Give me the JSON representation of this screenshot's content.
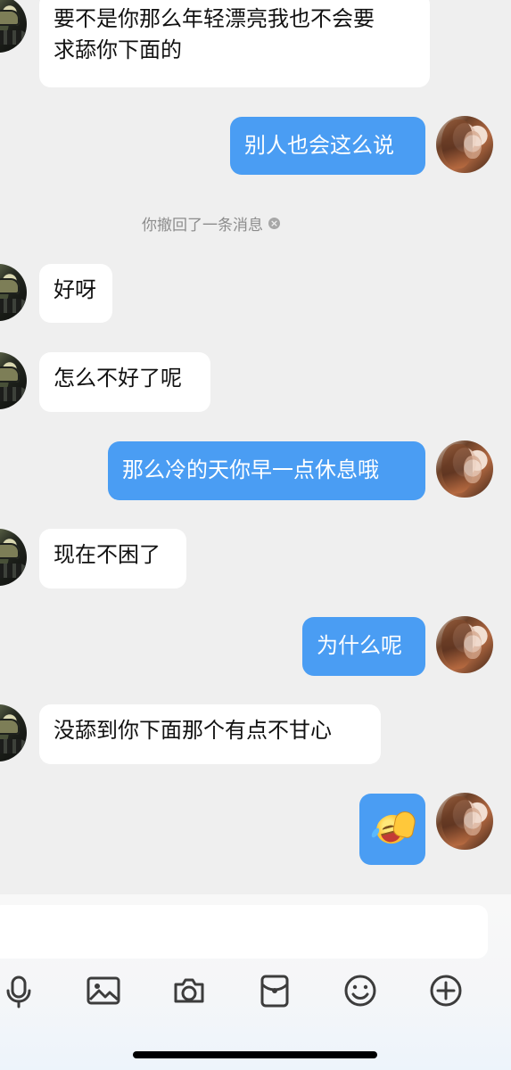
{
  "messages": [
    {
      "type": "incoming",
      "text": "要不是你那么年轻漂亮我也不会要\n求舔你下面的"
    },
    {
      "type": "outgoing",
      "text": "别人也会这么说"
    },
    {
      "type": "notice",
      "text": "你撤回了一条消息"
    },
    {
      "type": "incoming",
      "text": "好呀"
    },
    {
      "type": "incoming",
      "text": "怎么不好了呢"
    },
    {
      "type": "outgoing",
      "text": "那么冷的天你早一点休息哦"
    },
    {
      "type": "incoming",
      "text": "现在不困了"
    },
    {
      "type": "outgoing",
      "text": "为什么呢"
    },
    {
      "type": "incoming",
      "text": "没舔到你下面那个有点不甘心"
    },
    {
      "type": "outgoing-emoji",
      "emoji": "laughing-face-emoji"
    }
  ],
  "input": {
    "value": ""
  },
  "toolbar": [
    {
      "icon": "microphone-icon"
    },
    {
      "icon": "image-icon"
    },
    {
      "icon": "camera-icon"
    },
    {
      "icon": "red-packet-icon"
    },
    {
      "icon": "emoji-icon"
    },
    {
      "icon": "plus-icon"
    }
  ],
  "colors": {
    "background": "#efefef",
    "outgoing_bubble": "#4a9df3",
    "incoming_bubble": "#ffffff",
    "icon": "#3c3c3c"
  }
}
